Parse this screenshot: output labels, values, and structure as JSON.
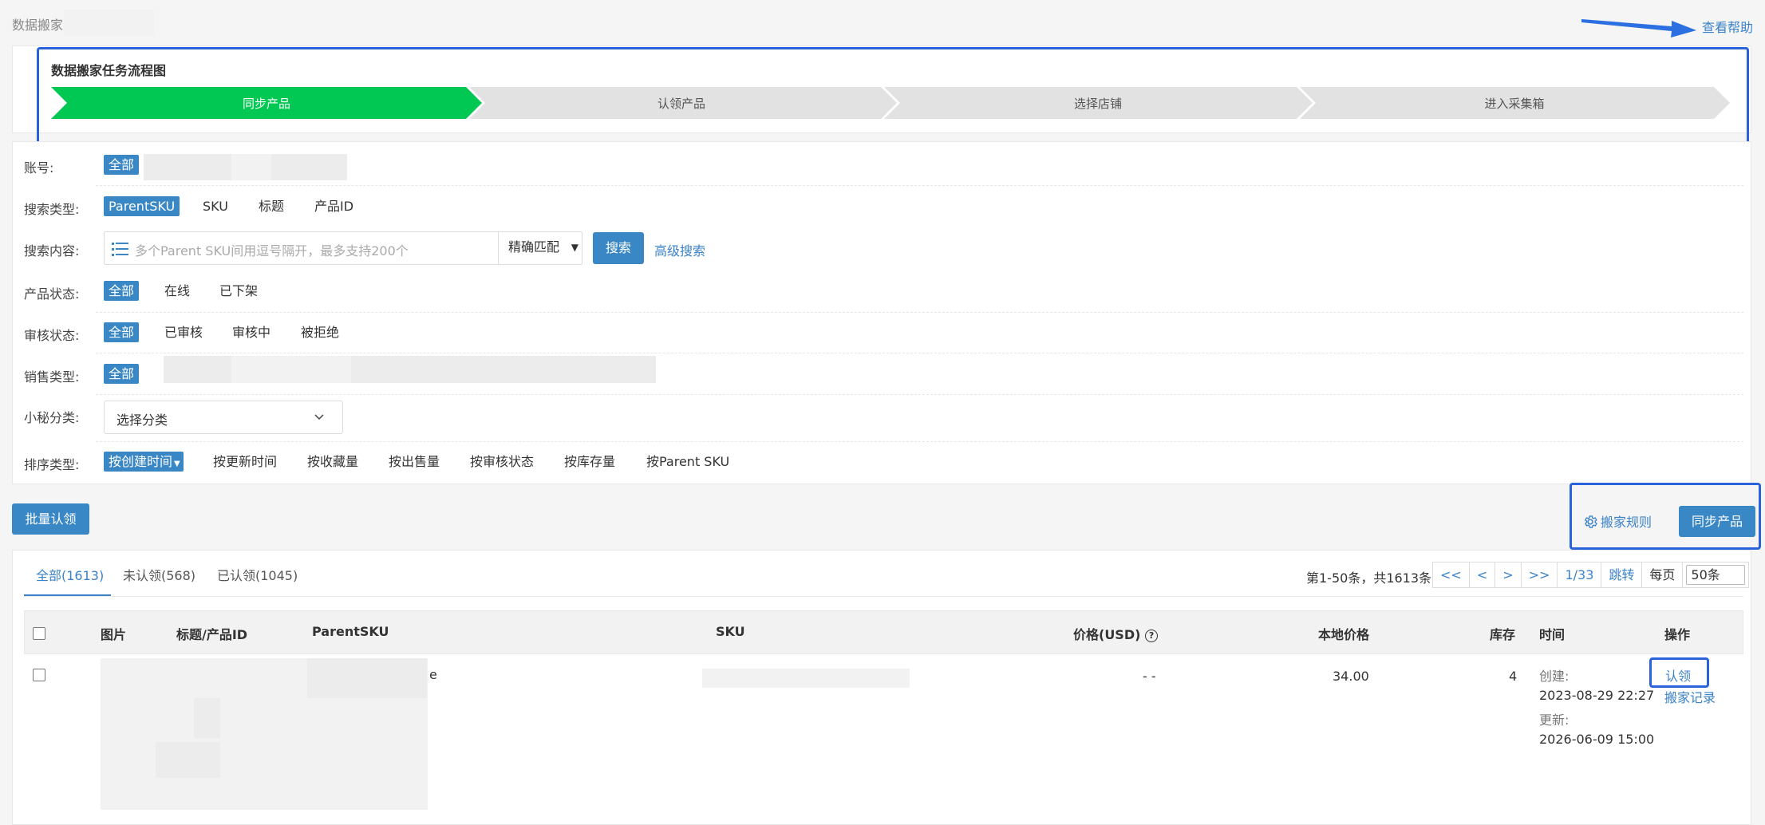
{
  "breadcrumb": {
    "title": "数据搬家"
  },
  "help_link": "查看帮助",
  "flow": {
    "title": "数据搬家任务流程图",
    "steps": [
      "同步产品",
      "认领产品",
      "选择店铺",
      "进入采集箱"
    ]
  },
  "filters": {
    "account": {
      "label": "账号:",
      "selected": "全部"
    },
    "search_type": {
      "label": "搜索类型:",
      "options": [
        "ParentSKU",
        "SKU",
        "标题",
        "产品ID"
      ]
    },
    "search_content": {
      "label": "搜索内容:",
      "placeholder": "多个Parent SKU间用逗号隔开，最多支持200个",
      "match": "精确匹配",
      "search_btn": "搜索",
      "advanced": "高级搜索"
    },
    "product_status": {
      "label": "产品状态:",
      "options": [
        "全部",
        "在线",
        "已下架"
      ]
    },
    "review_status": {
      "label": "审核状态:",
      "options": [
        "全部",
        "已审核",
        "审核中",
        "被拒绝"
      ]
    },
    "sale_type": {
      "label": "销售类型:",
      "selected": "全部"
    },
    "category": {
      "label": "小秘分类:",
      "placeholder": "选择分类"
    },
    "sort": {
      "label": "排序类型:",
      "options": [
        "按创建时间",
        "按更新时间",
        "按收藏量",
        "按出售量",
        "按审核状态",
        "按库存量",
        "按Parent SKU"
      ]
    }
  },
  "toolbar": {
    "batch_claim": "批量认领",
    "rules": "搬家规则",
    "sync": "同步产品"
  },
  "tabs": [
    "全部(1613)",
    "未认领(568)",
    "已认领(1045)"
  ],
  "pagination": {
    "summary": "第1-50条，共1613条",
    "first": "<<",
    "prev": "<",
    "next": ">",
    "last": ">>",
    "page": "1/33",
    "jump": "跳转",
    "per_page_label": "每页",
    "per_page": "50条"
  },
  "table": {
    "headers": [
      "图片",
      "标题/产品ID",
      "ParentSKU",
      "SKU",
      "价格(USD)",
      "本地价格",
      "库存",
      "时间",
      "操作"
    ],
    "rows": [
      {
        "title_suffix": "e",
        "price": "- -",
        "local_price": "34.00",
        "stock": "4",
        "created_label": "创建:",
        "created": "2023-08-29 22:27",
        "updated_label": "更新:",
        "updated": "2026-06-09 15:00",
        "action_claim": "认领",
        "action_history": "搬家记录"
      }
    ]
  },
  "colors": {
    "accent": "#3a87c6",
    "step_active": "#00c853",
    "highlight": "#2a62dc"
  }
}
